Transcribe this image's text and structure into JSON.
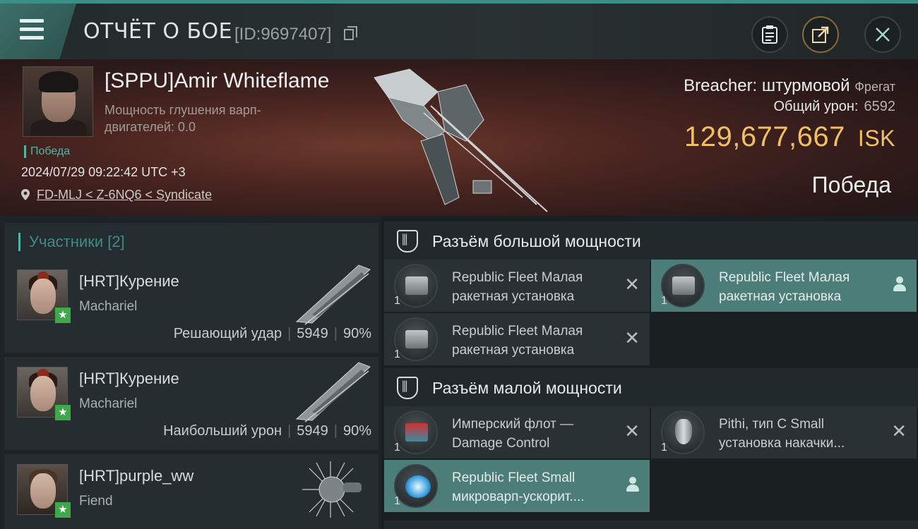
{
  "header": {
    "title": "ОТЧЁТ О БОЕ",
    "report_id": "[ID:9697407]",
    "buttons": {
      "menu": "menu-icon",
      "clipboard": "clipboard-icon",
      "share": "share-icon",
      "close": "close-icon"
    },
    "accent_color": "#3c8f86"
  },
  "victim": {
    "name": "[SPPU]Amir Whiteflame",
    "jam_label": "Мощность глушения варп-двигателей: 0.0",
    "status": "Победа",
    "datetime": "2024/07/29 09:22:42 UTC +3",
    "location": "FD-MLJ < Z-6NQ6 < Syndicate",
    "ship_name": "Breacher: штурмовой",
    "ship_class": "Фрегат",
    "total_damage_label": "Общий урон:",
    "total_damage": "6592",
    "isk_value": "129,677,667",
    "isk_unit": "ISK",
    "isk_color": "#f2c060",
    "outcome": "Победа"
  },
  "participants": {
    "heading": "Участники [2]",
    "items": [
      {
        "name": "[HRT]Курение",
        "ship": "Machariel",
        "role": "Решающий удар",
        "damage": "5949",
        "percent": "90%"
      },
      {
        "name": "[HRT]Курение",
        "ship": "Machariel",
        "role": "Наибольший урон",
        "damage": "5949",
        "percent": "90%"
      },
      {
        "name": "[HRT]purple_ww",
        "ship": "Fiend",
        "role": "",
        "damage": "",
        "percent": ""
      }
    ]
  },
  "slots": {
    "high": {
      "heading": "Разъём большой мощности",
      "items": [
        {
          "name": "Republic Fleet Малая ракетная установка",
          "qty": "1",
          "state": "destroyed"
        },
        {
          "name": "Republic Fleet Малая ракетная установка",
          "qty": "1",
          "state": "dropped"
        },
        {
          "name": "Republic Fleet Малая ракетная установка",
          "qty": "1",
          "state": "destroyed"
        }
      ]
    },
    "low": {
      "heading": "Разъём малой мощности",
      "items": [
        {
          "name": "Имперский флот — Damage Control",
          "qty": "1",
          "state": "destroyed"
        },
        {
          "name": "Pithi, тип C Small установка накачки...",
          "qty": "1",
          "state": "destroyed"
        },
        {
          "name": "Republic Fleet Small микроварп-ускорит....",
          "qty": "1",
          "state": "dropped"
        }
      ]
    },
    "highlight_color": "#4c7d78"
  }
}
